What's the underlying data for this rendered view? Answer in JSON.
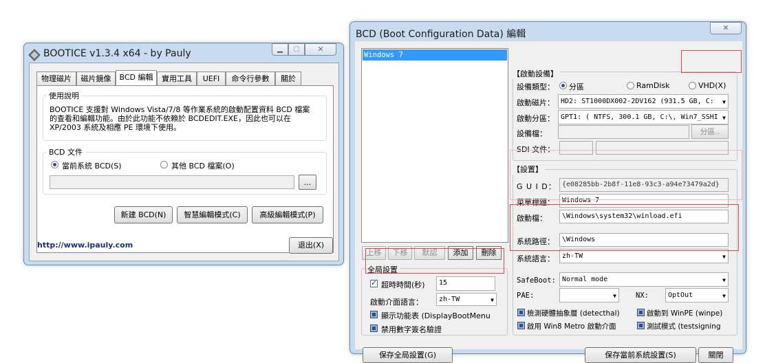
{
  "bootice": {
    "title": "BOOTICE v1.3.4 x64 - by Pauly",
    "tabs": [
      "物理磁片",
      "磁片鏡像",
      "BCD 編輯",
      "實用工具",
      "UEFI",
      "命令行參數",
      "關於"
    ],
    "usage_group_label": "使用說明",
    "usage_lines": [
      "BOOTICE 支援對 Windows Vista/7/8 等作業系統的啟動配置資料 BCD 檔案",
      "的查看和編輯功能。由於此功能不依賴於 BCDEDIT.EXE，因此也可以在",
      "XP/2003 系統及相應 PE 環境下使用。"
    ],
    "bcd_file_group_label": "BCD 文件",
    "radio_current": "當前系統 BCD(S)",
    "radio_other": "其他 BCD 檔案(O)",
    "browse_label": "...",
    "buttons": {
      "new_bcd": "新建 BCD(N)",
      "smart_edit": "智慧編輯模式(C)",
      "advanced_edit": "高級編輯模式(P)",
      "exit": "退出(X)"
    },
    "website": "http://www.ipauly.com"
  },
  "bcd": {
    "title": "BCD (Boot Configuration Data) 編輯",
    "entries": [
      "Windows 7"
    ],
    "list_buttons": {
      "up": "上移",
      "down": "下移",
      "default": "默認",
      "add": "添加",
      "delete": "刪除"
    },
    "global": {
      "label": "全局設置",
      "timeout_label": "超時時間(秒)",
      "timeout_value": "15",
      "lang_label": "啟動介面語言：",
      "lang_value": "zh-TW",
      "show_menu": "顯示功能表 (DisplayBootMenu",
      "no_integrity": "禁用數字簽名驗證"
    },
    "device": {
      "label": "【啟動設備】",
      "type_label": "設備類型：",
      "type_partition": "分區",
      "type_ramdisk": "RamDisk",
      "type_vhd": "VHD(X)",
      "disk_label": "啟動磁片：",
      "disk_value": "HD2: ST1000DX002-2DV162 (931.5 GB, C:",
      "partition_label": "啟動分區：",
      "partition_value": "GPT1: ( NTFS, 300.1 GB, C:\\, Win7_SSHI",
      "device_file_label": "設備檔：",
      "partition_btn": "分區..",
      "sdi_label": "SDI 文件："
    },
    "settings": {
      "label": "【設置】",
      "guid_label": "G U I D：",
      "guid_value": "{e08285bb-2b8f-11e8-93c3-a94e73479a2d}",
      "menu_title_label": "菜單標題：",
      "menu_title_value": "Windows 7",
      "boot_file_label": "啟動檔：",
      "boot_file_value": "\\Windows\\system32\\winload.efi",
      "sys_path_label": "系統路徑：",
      "sys_path_value": "\\Windows",
      "sys_lang_label": "系統語言：",
      "sys_lang_value": "zh-TW",
      "safeboot_label": "SafeBoot:",
      "safeboot_value": "Normal mode",
      "pae_label": "PAE:",
      "pae_value": "",
      "nx_label": "NX:",
      "nx_value": "OptOut",
      "detecthal": "檢測硬體抽象層 (detecthal)",
      "winpe": "啟動到 WinPE (winpe)",
      "metro": "啟用 Win8 Metro 啟動介面",
      "testsigning": "測試模式 (testsigning"
    },
    "buttons": {
      "save_global": "保存全局設置(G)",
      "save_current": "保存當前系統設置(S)",
      "close": "關閉"
    }
  }
}
